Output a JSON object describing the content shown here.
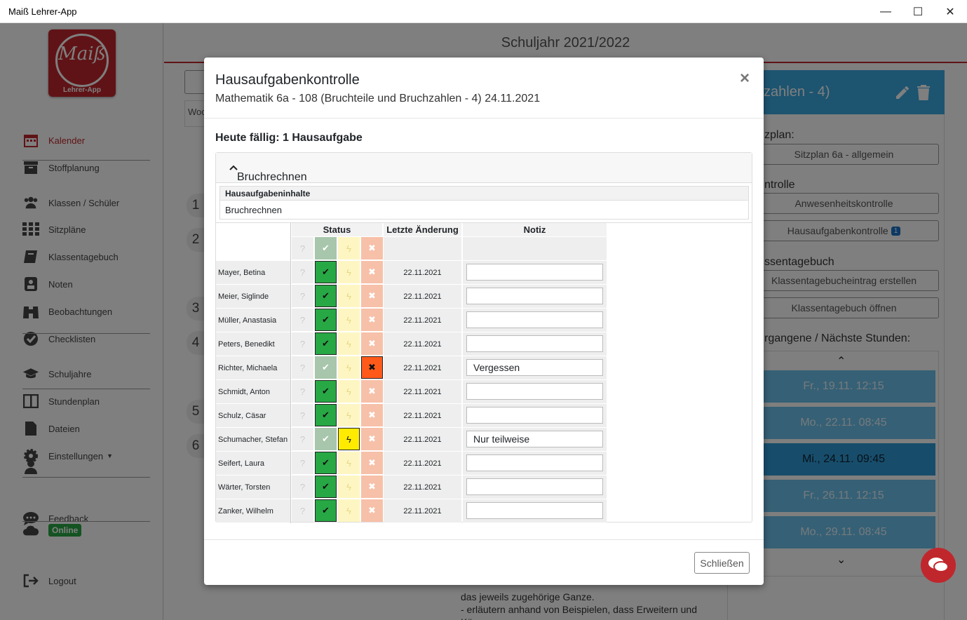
{
  "window": {
    "title": "Maiß Lehrer-App",
    "minimize": "—",
    "maximize": "☐",
    "close": "✕"
  },
  "logo": {
    "text": "Maiß",
    "sub": "Lehrer-App"
  },
  "sidebar": {
    "items": [
      {
        "label": "Kalender",
        "icon": "calendar-icon"
      },
      {
        "label": "Stoffplanung",
        "icon": "box-icon"
      },
      {
        "label": "Klassen / Schüler",
        "icon": "users-icon"
      },
      {
        "label": "Sitzpläne",
        "icon": "grid-icon"
      },
      {
        "label": "Klassentagebuch",
        "icon": "book-icon"
      },
      {
        "label": "Noten",
        "icon": "grade-icon"
      },
      {
        "label": "Beobachtungen",
        "icon": "binoculars-icon"
      },
      {
        "label": "Checklisten",
        "icon": "check-circle-icon"
      },
      {
        "label": "Schuljahre",
        "icon": "graduation-cap-icon"
      },
      {
        "label": "Stundenplan",
        "icon": "columns-icon"
      },
      {
        "label": "Dateien",
        "icon": "file-icon"
      },
      {
        "label": "Einstellungen",
        "icon": "gear-icon"
      },
      {
        "label": "Feedback",
        "icon": "chat-icon"
      },
      {
        "label": "Logout",
        "icon": "logout-icon"
      }
    ],
    "online_label": "Online"
  },
  "background": {
    "year_title": "Schuljahr 2021/2022",
    "header_fragment": "zahlen - 4)",
    "sitzplan_label": "zplan:",
    "sitzplan_button": "Sitzplan 6a - allgemein",
    "kontrolle_label": "ntrolle",
    "anwesenheit_button": "Anwesenheitskontrolle",
    "hausaufgaben_button": "Hausaufgabenkontrolle",
    "hausaufgaben_badge": "1",
    "tagebuch_label": "ssentagebuch",
    "tagebuch_create_button": "Klassentagebucheintrag erstellen",
    "tagebuch_open_button": "Klassentagebuch öffnen",
    "stunden_label": "rgangene / Nächste Stunden:",
    "slots": [
      "Fr., 19.11. 12:15",
      "Mo., 22.11. 08:45",
      "Mi., 24.11. 09:45",
      "Fr., 26.11. 12:15",
      "Mo., 29.11. 08:45"
    ],
    "week_fragment": "Woc",
    "row_numbers": [
      "1",
      "2",
      "3",
      "4",
      "5",
      "6"
    ],
    "text_lines": [
      "das jeweils zugehörige Ganze.",
      "- erläutern anhand von Beispielen, dass Erweitern und Kürzen"
    ]
  },
  "modal": {
    "title": "Hausaufgabenkontrolle",
    "subtitle": "Mathematik 6a - 108 (Bruchteile und Bruchzahlen - 4) 24.11.2021",
    "due_title": "Heute fällig: 1 Hausaufgabe",
    "homework_title": "Bruchrechnen",
    "contents_header": "Hausaufgabeninhalte",
    "contents_value": "Bruchrechnen",
    "columns": {
      "status": "Status",
      "last_change": "Letzte Änderung",
      "note": "Notiz"
    },
    "status_symbols": {
      "unknown": "?",
      "done": "✔",
      "partial": "ϟ",
      "missing": "✖"
    },
    "students": [
      {
        "name": "Mayer, Betina",
        "status": "done",
        "date": "22.11.2021",
        "note": ""
      },
      {
        "name": "Meier, Siglinde",
        "status": "done",
        "date": "22.11.2021",
        "note": ""
      },
      {
        "name": "Müller, Anastasia",
        "status": "done",
        "date": "22.11.2021",
        "note": ""
      },
      {
        "name": "Peters, Benedikt",
        "status": "done",
        "date": "22.11.2021",
        "note": ""
      },
      {
        "name": "Richter, Michaela",
        "status": "missing",
        "date": "22.11.2021",
        "note": "Vergessen"
      },
      {
        "name": "Schmidt, Anton",
        "status": "done",
        "date": "22.11.2021",
        "note": ""
      },
      {
        "name": "Schulz, Cäsar",
        "status": "done",
        "date": "22.11.2021",
        "note": ""
      },
      {
        "name": "Schumacher, Stefan",
        "status": "partial",
        "date": "22.11.2021",
        "note": "Nur teilweise"
      },
      {
        "name": "Seifert, Laura",
        "status": "done",
        "date": "22.11.2021",
        "note": ""
      },
      {
        "name": "Wärter, Torsten",
        "status": "done",
        "date": "22.11.2021",
        "note": ""
      },
      {
        "name": "Zanker, Wilhelm",
        "status": "done",
        "date": "22.11.2021",
        "note": ""
      }
    ],
    "close_button": "Schließen",
    "close_icon": "×"
  },
  "colors": {
    "brand": "#c0272d",
    "accent": "#3aa8e0",
    "done": "#28a745",
    "partial": "#ffeb00",
    "missing": "#ff5a1a"
  }
}
